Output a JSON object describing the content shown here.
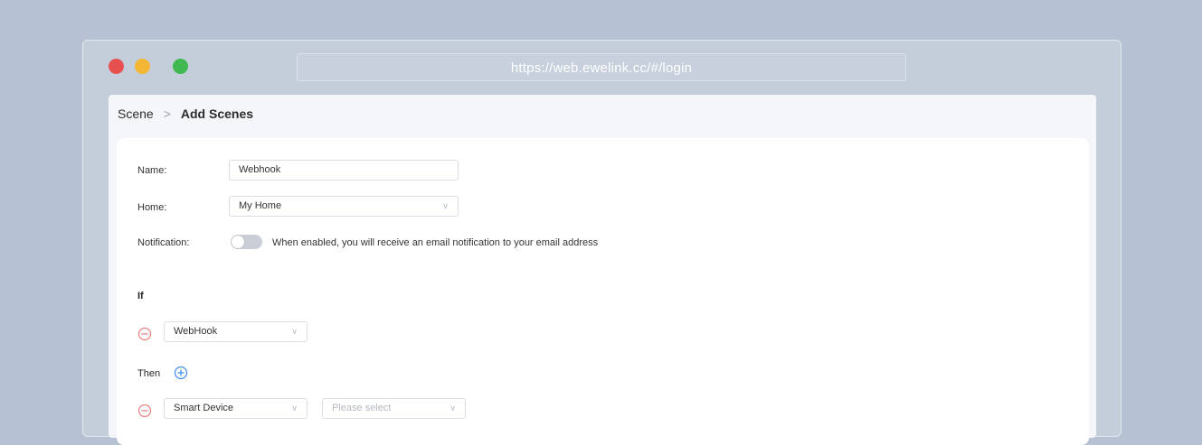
{
  "browser": {
    "url": "https://web.ewelink.cc/#/login",
    "window_controls": [
      "close",
      "minimize",
      "maximize"
    ]
  },
  "breadcrumb": {
    "parent": "Scene",
    "separator": ">",
    "current": "Add Scenes"
  },
  "form": {
    "name": {
      "label": "Name:",
      "value": "Webhook"
    },
    "home": {
      "label": "Home:",
      "value": "My Home"
    },
    "notification": {
      "label": "Notification:",
      "enabled": false,
      "hint": "When enabled, you will receive an email notification to your email address"
    }
  },
  "if_section": {
    "label": "If",
    "condition": {
      "value": "WebHook"
    }
  },
  "then_section": {
    "label": "Then",
    "action": {
      "type_value": "Smart Device",
      "target_placeholder": "Please select"
    }
  },
  "colors": {
    "background": "#b6c2d3",
    "remove_icon": "#e8827f",
    "add_icon": "#3d8ef0"
  }
}
